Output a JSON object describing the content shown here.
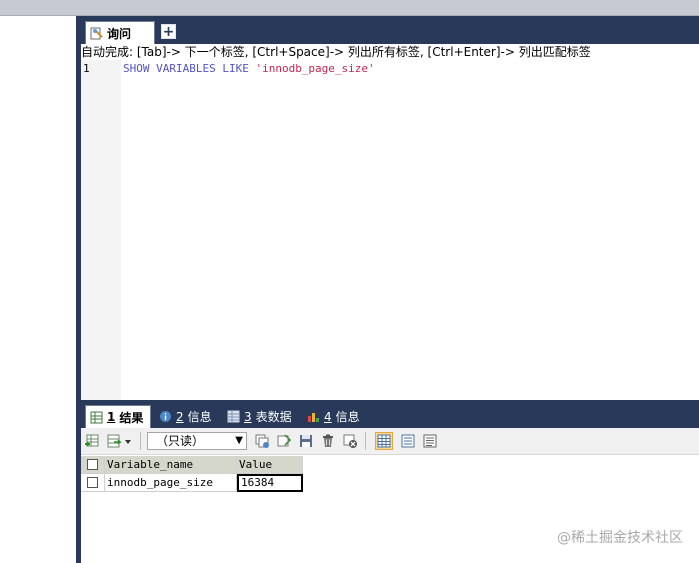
{
  "query_tab": {
    "label": "询问",
    "add_label": "+"
  },
  "hint": "自动完成: [Tab]-> 下一个标签, [Ctrl+Space]-> 列出所有标签, [Ctrl+Enter]-> 列出匹配标签",
  "editor": {
    "line_number": "1",
    "code_keywords": "SHOW VARIABLES LIKE ",
    "code_string": "'innodb_page_size'"
  },
  "result_tabs": [
    {
      "num": "1",
      "label": "结果"
    },
    {
      "num": "2",
      "label": "信息"
    },
    {
      "num": "3",
      "label": "表数据"
    },
    {
      "num": "4",
      "label": "信息"
    }
  ],
  "toolbar": {
    "readonly_label": "（只读）"
  },
  "grid": {
    "columns": [
      "Variable_name",
      "Value"
    ],
    "rows": [
      [
        "innodb_page_size",
        "16384"
      ]
    ]
  },
  "watermark": "@稀土掘金技术社区",
  "colors": {
    "dark_panel": "#29395a",
    "header_bg": "#d5d6cc",
    "keyword": "#5353c6",
    "string": "#c7254e"
  }
}
